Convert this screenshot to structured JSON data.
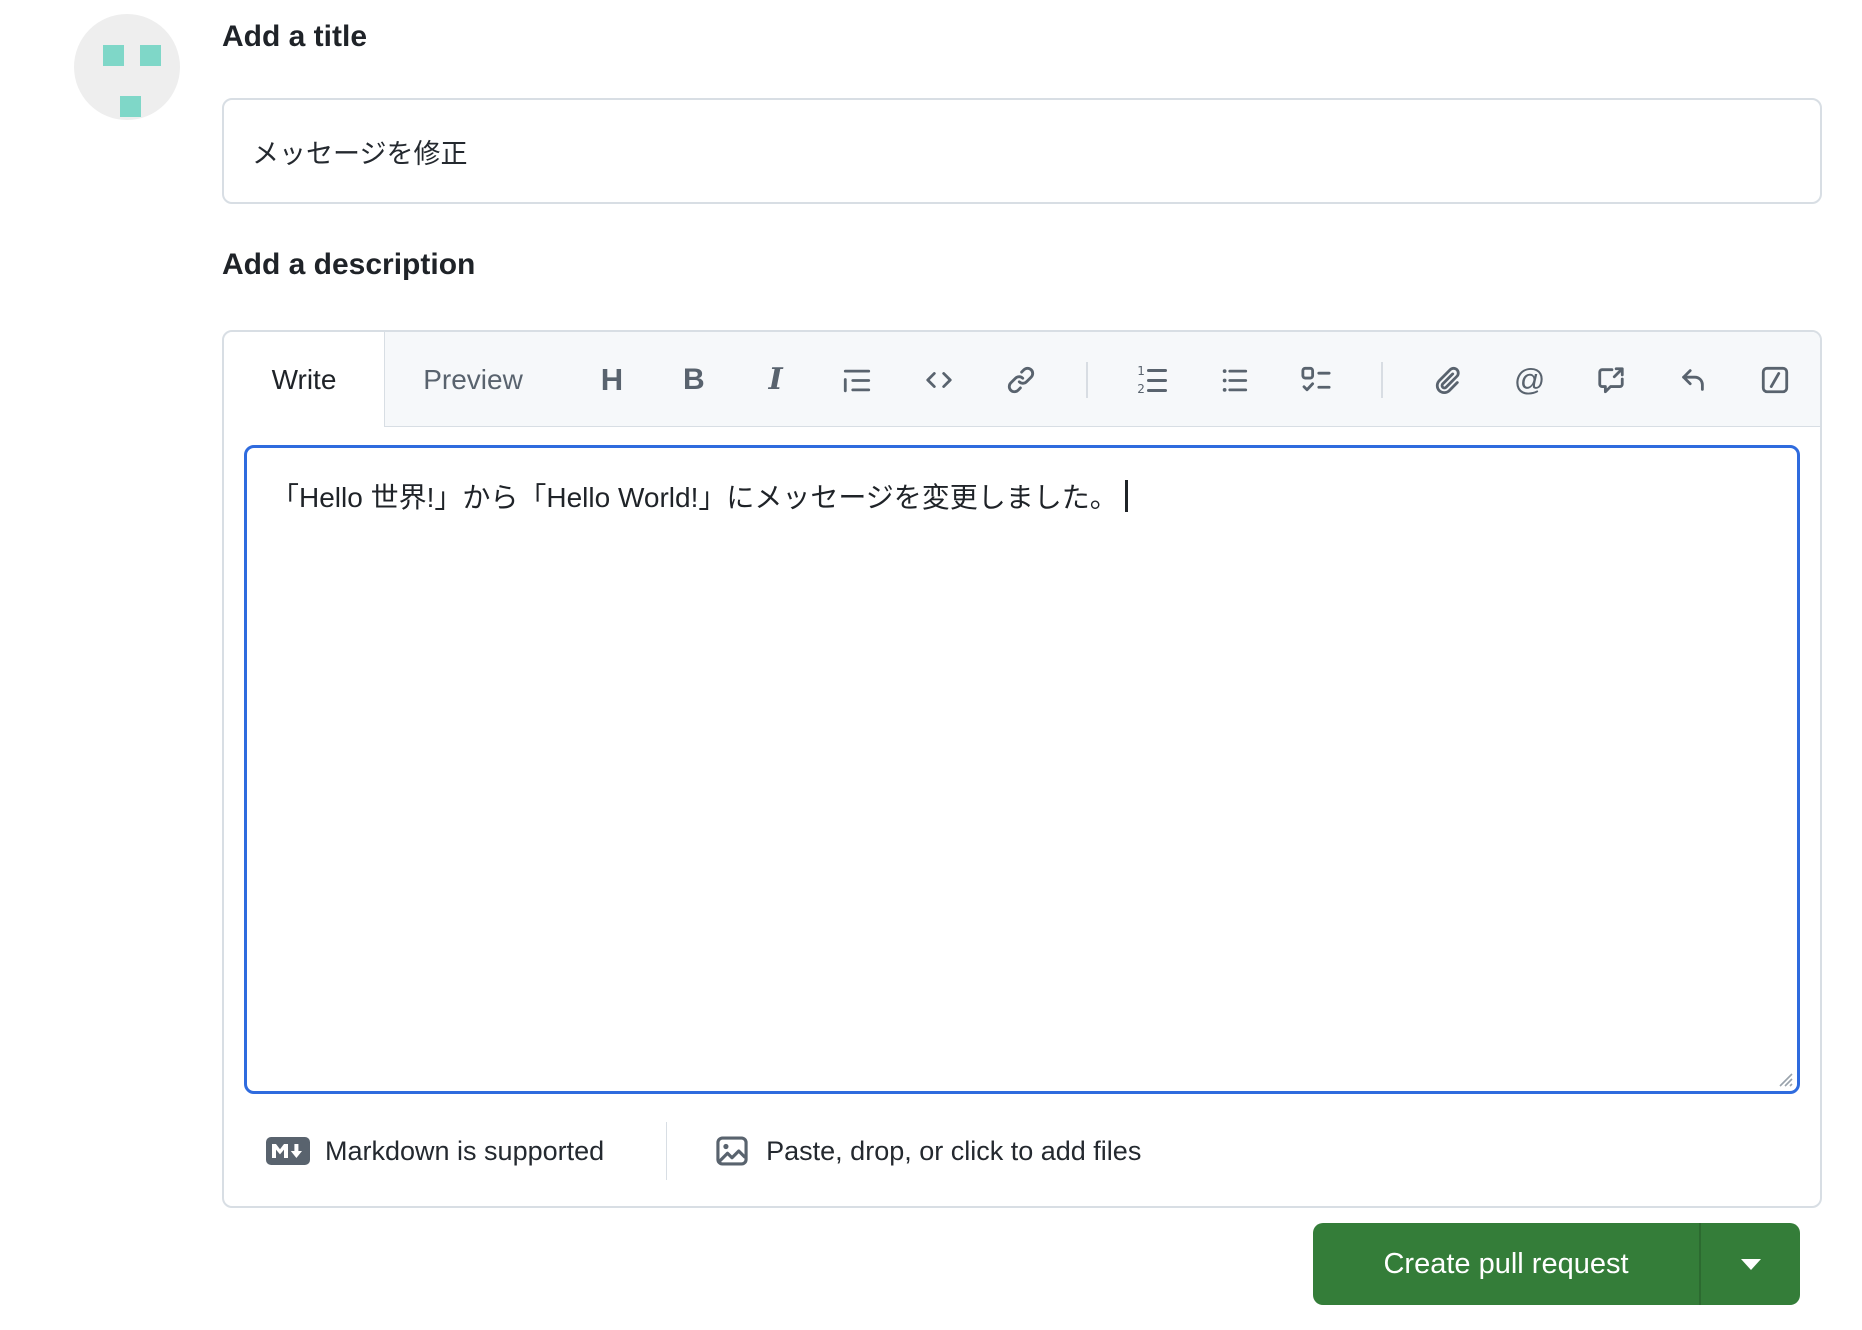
{
  "colors": {
    "accent_green": "#347d39",
    "focus_blue": "#2f6bde",
    "border_gray": "#d8dee4",
    "toolbar_bg": "#f6f8fa",
    "icon_gray": "#59636e",
    "avatar_teal": "#7fd7c8"
  },
  "avatar": {
    "name": "identicon-avatar"
  },
  "title_section": {
    "heading": "Add a title",
    "input_value": "メッセージを修正"
  },
  "description_section": {
    "heading": "Add a description"
  },
  "editor": {
    "tabs": [
      {
        "label": "Write",
        "active": true
      },
      {
        "label": "Preview",
        "active": false
      }
    ],
    "toolbar_icons": [
      {
        "name": "heading-icon",
        "glyph": "H"
      },
      {
        "name": "bold-icon",
        "glyph": "B"
      },
      {
        "name": "italic-icon",
        "glyph": "I"
      },
      {
        "name": "quote-icon"
      },
      {
        "name": "code-icon"
      },
      {
        "name": "link-icon"
      },
      {
        "name": "numbered-list-icon"
      },
      {
        "name": "bullet-list-icon"
      },
      {
        "name": "task-list-icon"
      },
      {
        "name": "attach-file-icon"
      },
      {
        "name": "mention-icon",
        "glyph": "@"
      },
      {
        "name": "cross-reference-icon"
      },
      {
        "name": "reply-icon"
      },
      {
        "name": "slash-command-icon"
      }
    ],
    "body_text": "「Hello 世界!」から「Hello World!」にメッセージを変更しました。",
    "footer": {
      "markdown_note": "Markdown is supported",
      "attach_note": "Paste, drop, or click to add files"
    }
  },
  "actions": {
    "create_button": "Create pull request"
  }
}
